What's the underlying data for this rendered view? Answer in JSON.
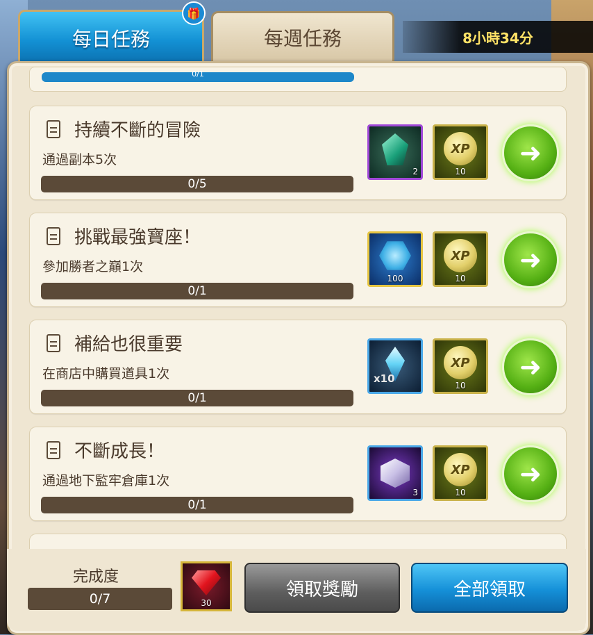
{
  "tabs": {
    "daily": "每日任務",
    "weekly": "每週任務"
  },
  "timer": "8小時34分",
  "top_progress": "0/1",
  "quests": [
    {
      "title": "持續不斷的冒險",
      "desc": "通過副本5次",
      "progress": "0/5",
      "reward1_count": "2",
      "reward2_count": "10"
    },
    {
      "title": "挑戰最強寶座！",
      "desc": "參加勝者之巔1次",
      "progress": "0/1",
      "reward1_count": "100",
      "reward2_count": "10"
    },
    {
      "title": "補給也很重要",
      "desc": "在商店中購買道具1次",
      "progress": "0/1",
      "reward1_count": "x10",
      "reward2_count": "10"
    },
    {
      "title": "不斷成長！",
      "desc": "通過地下監牢倉庫1次",
      "progress": "0/1",
      "reward1_count": "3",
      "reward2_count": "10"
    }
  ],
  "xp_text": "XP",
  "footer": {
    "completion_label": "完成度",
    "completion_value": "0/7",
    "ruby_count": "30",
    "claim": "領取獎勵",
    "claim_all": "全部領取"
  }
}
